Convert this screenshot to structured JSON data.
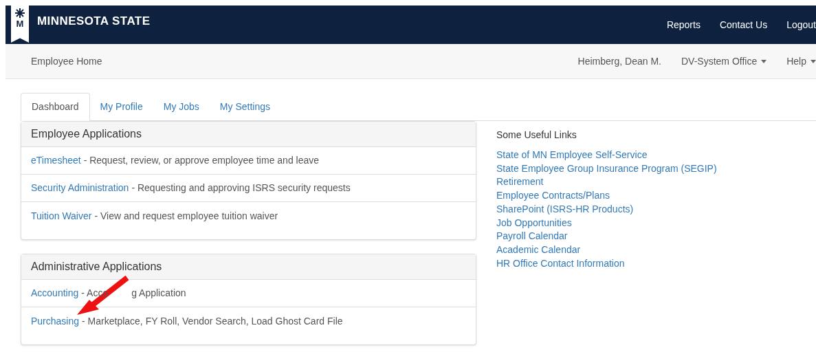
{
  "brand": {
    "mark": "M",
    "name": "MINNESOTA STATE"
  },
  "top_nav": [
    "Reports",
    "Contact Us",
    "Logout"
  ],
  "sub_nav": {
    "title": "Employee Home",
    "user": "Heimberg, Dean M.",
    "menus": [
      {
        "label": "DV-System Office",
        "dropdown": true
      },
      {
        "label": "Help",
        "dropdown": true
      }
    ]
  },
  "tabs": [
    {
      "label": "Dashboard",
      "selected": true
    },
    {
      "label": "My Profile",
      "selected": false
    },
    {
      "label": "My Jobs",
      "selected": false
    },
    {
      "label": "My Settings",
      "selected": false
    }
  ],
  "panels": [
    {
      "title": "Employee Applications",
      "items": [
        {
          "link": "eTimesheet",
          "description": "- Request, review, or approve employee time and leave"
        },
        {
          "link": "Security Administration",
          "description": "- Requesting and approving ISRS security requests"
        },
        {
          "link": "Tuition Waiver",
          "description": "- View and request employee tuition waiver"
        }
      ]
    },
    {
      "title": "Administrative Applications",
      "items": [
        {
          "link": "Accounting",
          "description": "- Acco",
          "description_after_arrow": "g Application"
        },
        {
          "link": "Purchasing",
          "description": "- Marketplace, FY Roll, Vendor Search, Load Ghost Card File"
        }
      ]
    }
  ],
  "useful_links": {
    "title": "Some Useful Links",
    "links": [
      "State of MN Employee Self-Service",
      "State Employee Group Insurance Program (SEGIP)",
      "Retirement",
      "Employee Contracts/Plans",
      "SharePoint (ISRS-HR Products)",
      "Job Opportunities",
      "Payroll Calendar",
      "Academic Calendar",
      "HR Office Contact Information"
    ]
  }
}
